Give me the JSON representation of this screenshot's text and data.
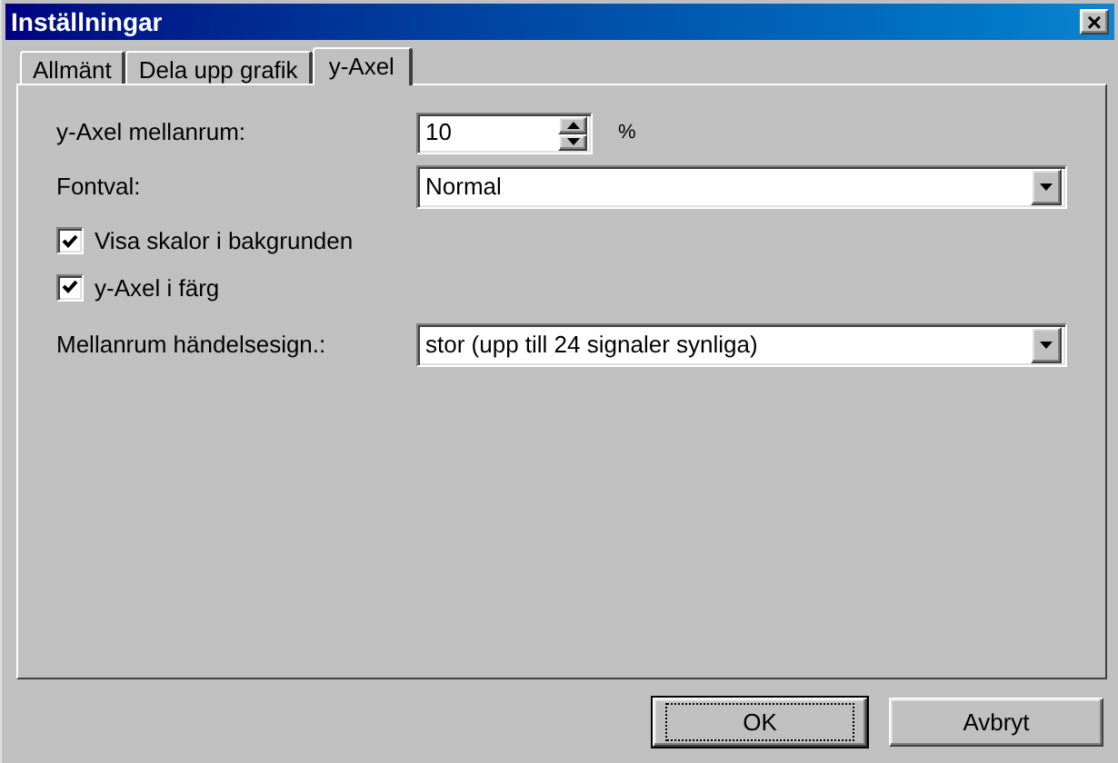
{
  "window": {
    "title": "Inställningar",
    "close": "×"
  },
  "tabs": [
    {
      "label": "Allmänt",
      "selected": false
    },
    {
      "label": "Dela upp grafik",
      "selected": false
    },
    {
      "label": "y-Axel",
      "selected": true
    }
  ],
  "spacing": {
    "label": "y-Axel mellanrum:",
    "value": "10",
    "unit": "%"
  },
  "font": {
    "label": "Fontval:",
    "value": "Normal"
  },
  "checkboxes": [
    {
      "label": "Visa skalor i bakgrunden",
      "checked": true
    },
    {
      "label": "y-Axel i färg",
      "checked": true
    }
  ],
  "event_spacing": {
    "label": "Mellanrum händelsesign.:",
    "value": "stor (upp till 24 signaler synliga)"
  },
  "buttons": [
    {
      "label": "OK",
      "default": true
    },
    {
      "label": "Avbryt",
      "default": false
    }
  ]
}
